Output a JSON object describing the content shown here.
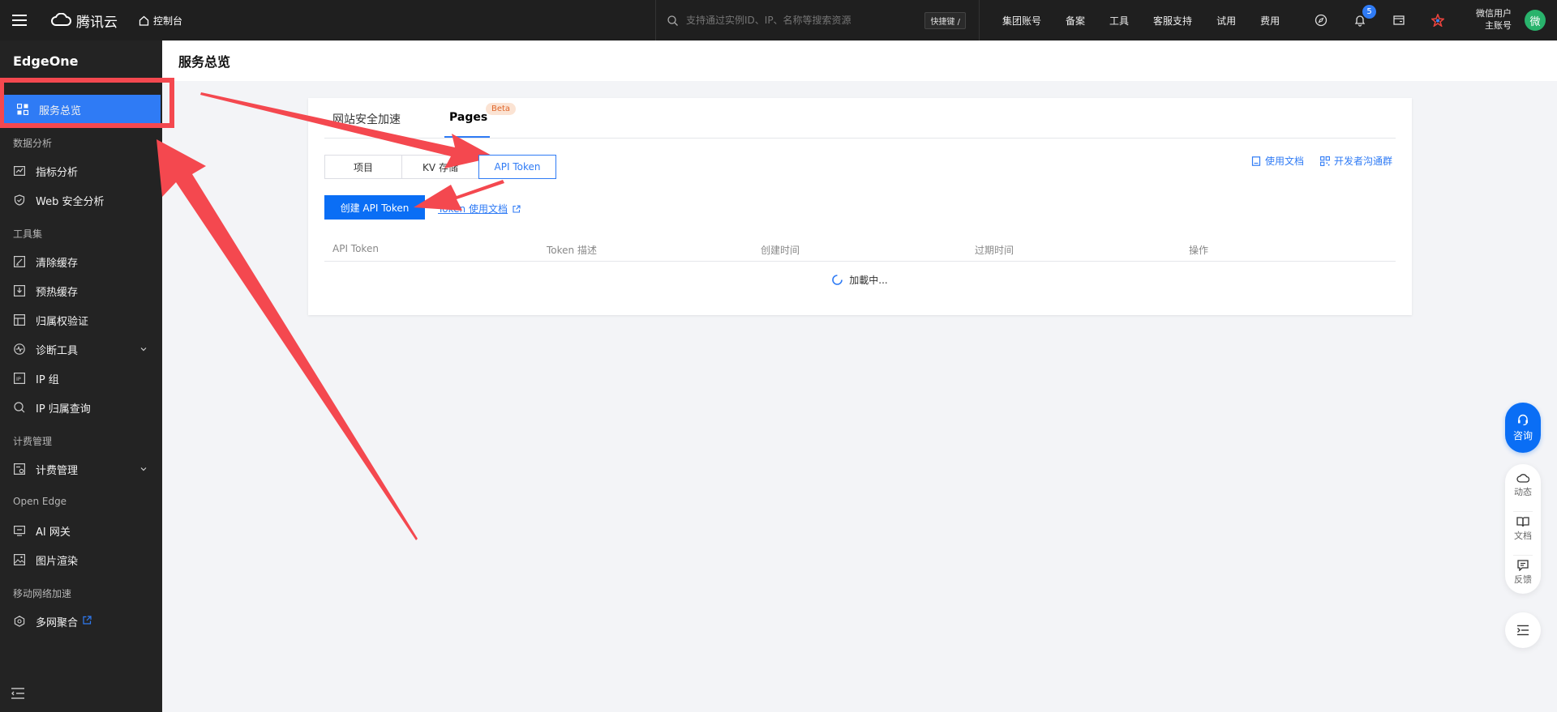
{
  "topbar": {
    "brand": "腾讯云",
    "console": "控制台",
    "search_placeholder": "支持通过实例ID、IP、名称等搜索资源",
    "shortcut": "快捷键 /",
    "links": [
      "集团账号",
      "备案",
      "工具",
      "客服支持",
      "试用",
      "费用"
    ],
    "notification_count": "5",
    "user_name": "微信用户",
    "user_role": "主账号",
    "avatar_text": "微"
  },
  "sidebar": {
    "title": "EdgeOne",
    "active_item": "服务总览",
    "group_data": "数据分析",
    "item_metrics": "指标分析",
    "item_web_security": "Web 安全分析",
    "group_tools": "工具集",
    "item_purge": "清除缓存",
    "item_prefetch": "预热缓存",
    "item_ownership": "归属权验证",
    "item_diagnose": "诊断工具",
    "item_ip_group": "IP 组",
    "item_ip_lookup": "IP 归属查询",
    "group_billing": "计费管理",
    "item_billing": "计费管理",
    "group_open_edge": "Open Edge",
    "item_ai_gateway": "AI 网关",
    "item_image": "图片渲染",
    "group_mobile": "移动网络加速",
    "item_multinet": "多网聚合"
  },
  "page": {
    "title": "服务总览"
  },
  "tabs": {
    "site_acceleration": "网站安全加速",
    "pages": "Pages",
    "beta": "Beta"
  },
  "subtabs": {
    "project": "项目",
    "kv": "KV 存储",
    "api_token": "API Token"
  },
  "links": {
    "docs": "使用文档",
    "community": "开发者沟通群"
  },
  "actions": {
    "create": "创建 API Token",
    "token_doc": "Token 使用文档"
  },
  "table": {
    "columns": [
      "API Token",
      "Token 描述",
      "创建时间",
      "过期时间",
      "操作"
    ],
    "loading": "加載中..."
  },
  "float": {
    "consult": "咨询",
    "dynamic": "动态",
    "docs": "文档",
    "feedback": "反馈"
  },
  "colors": {
    "primary": "#0a6ef5",
    "annotation": "#f4484f",
    "topbar": "#1f1f1f",
    "sidebar": "#232323"
  }
}
